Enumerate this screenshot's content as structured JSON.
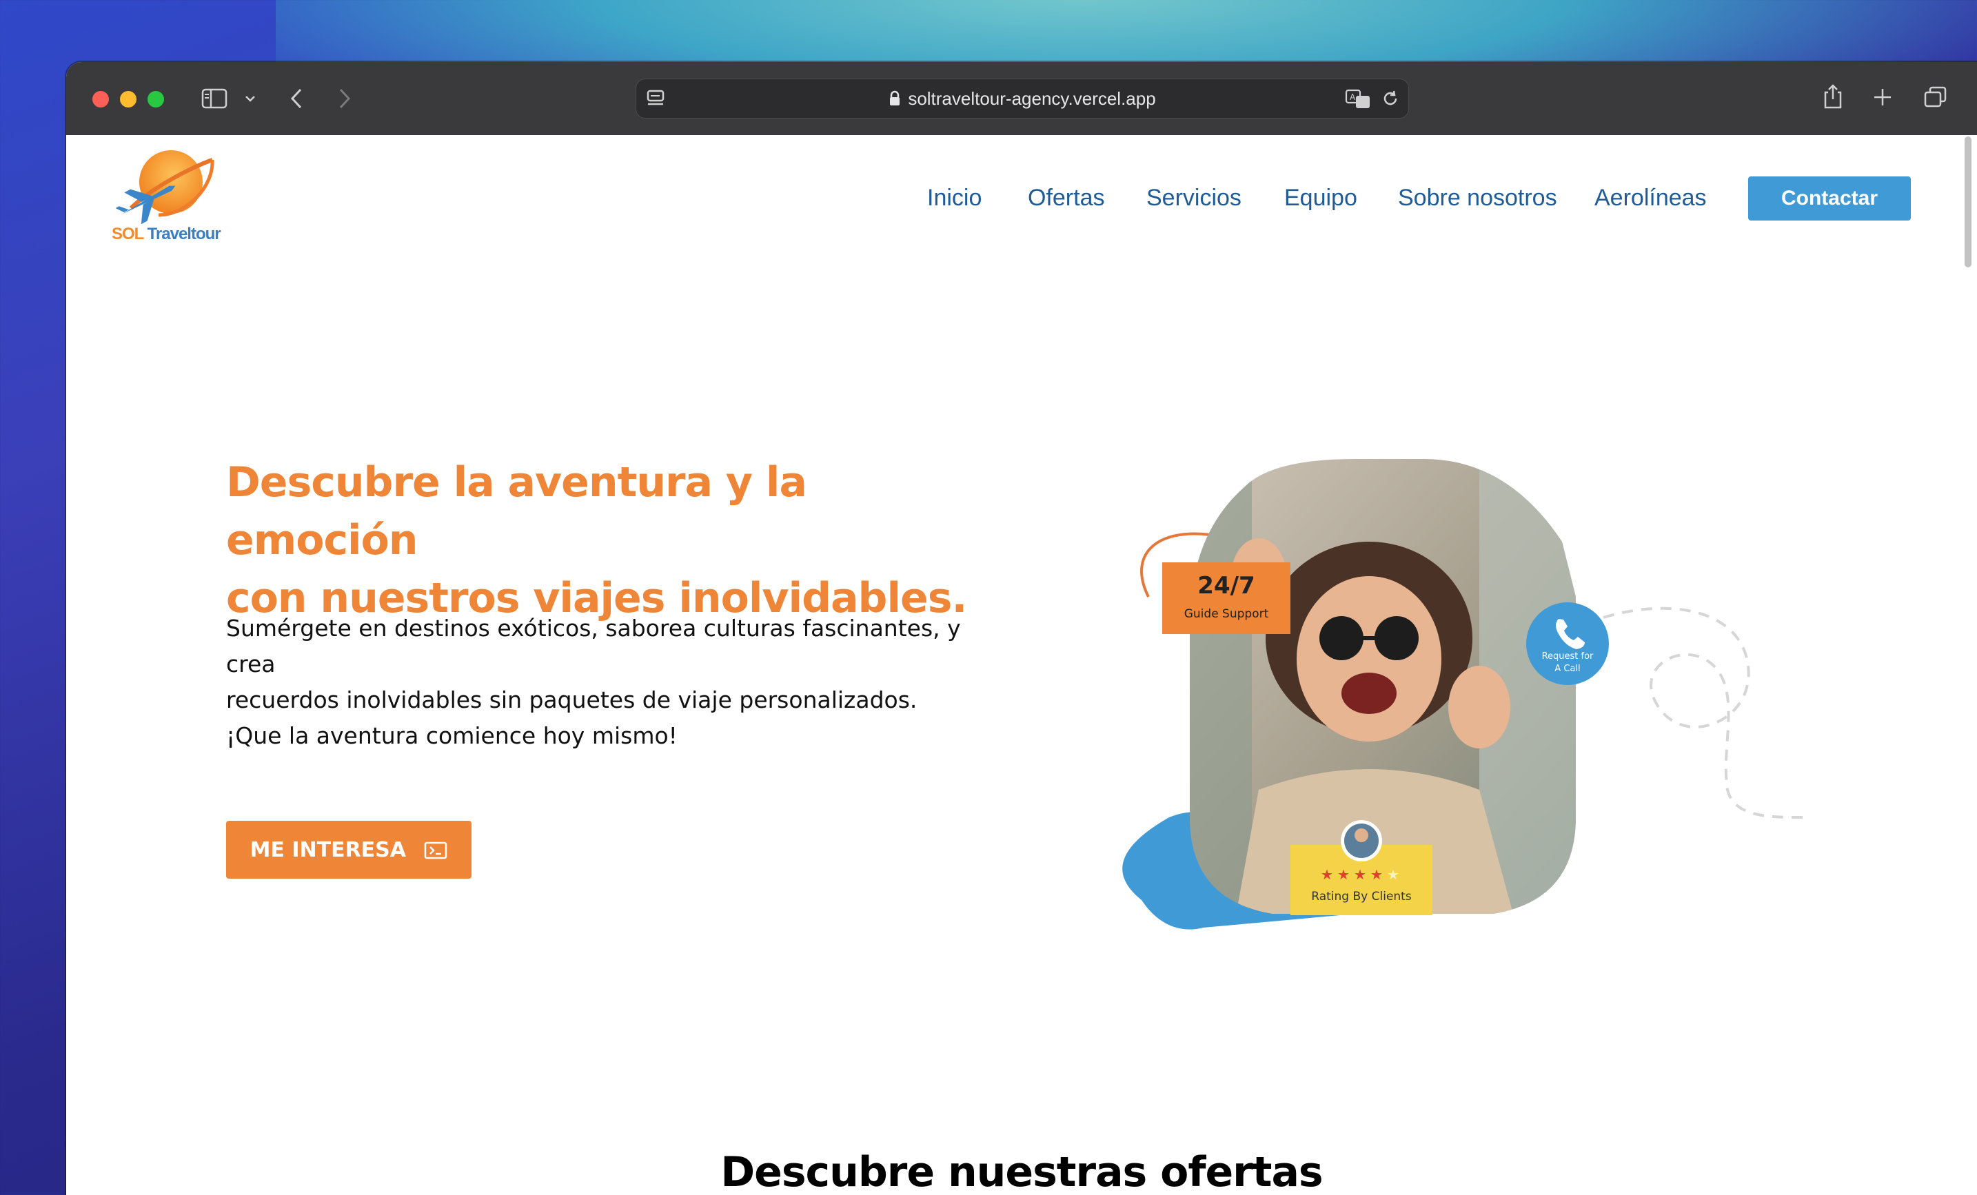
{
  "browser": {
    "url": "soltraveltour-agency.vercel.app"
  },
  "site": {
    "logo": {
      "part1": "SOL",
      "part2": "Traveltour"
    },
    "nav": [
      "Inicio",
      "Ofertas",
      "Servicios",
      "Equipo",
      "Sobre nosotros",
      "Aerolíneas"
    ],
    "contact_label": "Contactar"
  },
  "hero": {
    "title_line1": "Descubre la aventura y la emoción",
    "title_line2": "con nuestros viajes inolvidables.",
    "desc_line1": "Sumérgete en destinos exóticos, saborea culturas fascinantes, y crea",
    "desc_line2": "recuerdos inolvidables sin paquetes de viaje personalizados.",
    "desc_line3": "¡Que la aventura comience hoy mismo!",
    "cta_label": "ME INTERESA",
    "badge_support_big": "24/7",
    "badge_support_small": "Guide Support",
    "badge_call_line1": "Request for",
    "badge_call_line2": "A Call",
    "badge_rating": "Rating By Clients",
    "rating_stars": 4
  },
  "section": {
    "title": "Descubre nuestras ofertas"
  },
  "colors": {
    "accent_orange": "#ef8536",
    "accent_blue": "#3f9ad6",
    "nav_blue": "#1f5b96"
  }
}
